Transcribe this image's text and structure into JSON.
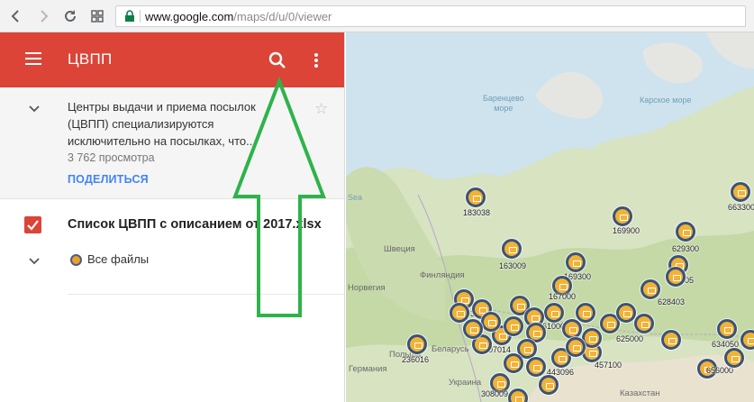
{
  "browser": {
    "url_host": "www.google.com",
    "url_path": "/maps/d/u/0/viewer",
    "nav": {
      "back_icon": "back-arrow-icon",
      "forward_icon": "forward-arrow-icon",
      "reload_icon": "reload-icon",
      "apps_icon": "apps-grid-icon"
    }
  },
  "appbar": {
    "title": "ЦВПП",
    "color": "#db4437"
  },
  "info": {
    "description": "Центры выдачи и приема посылок (ЦВПП) специализируются исключительно на посылках, что...",
    "views": "3 762 просмотра",
    "share_label": "ПОДЕЛИТЬСЯ"
  },
  "layer": {
    "title": "Список ЦВПП с описанием от 2017.xlsx",
    "checked": true,
    "all_files_label": "Все файлы"
  },
  "map": {
    "seas": [
      {
        "id": "barents",
        "text": "Баренцево море"
      },
      {
        "id": "kara",
        "text": "Карское море"
      },
      {
        "id": "sea",
        "text": "Sea"
      }
    ],
    "countries": [
      {
        "id": "sweden",
        "text": "Швеция"
      },
      {
        "id": "finland",
        "text": "Финляндия"
      },
      {
        "id": "norway",
        "text": "Норвегия"
      },
      {
        "id": "belarus",
        "text": "Беларусь"
      },
      {
        "id": "poland",
        "text": "Польша"
      },
      {
        "id": "germany",
        "text": "Германия"
      },
      {
        "id": "ukraine",
        "text": "Украина"
      },
      {
        "id": "kazakhstan",
        "text": "Казахстан"
      }
    ],
    "markers": [
      {
        "label": "183038"
      },
      {
        "label": "169900"
      },
      {
        "label": "629300"
      },
      {
        "label": "663300"
      },
      {
        "label": "163009"
      },
      {
        "label": "169300"
      },
      {
        "label": "629805"
      },
      {
        "label": "167000"
      },
      {
        "label": "628403"
      },
      {
        "label": "191033"
      },
      {
        "label": "610000"
      },
      {
        "label": "625000"
      },
      {
        "label": "634050"
      },
      {
        "label": "107014"
      },
      {
        "label": "236016"
      },
      {
        "label": "457100"
      },
      {
        "label": "443096"
      },
      {
        "label": "656000"
      },
      {
        "label": "308009"
      }
    ]
  }
}
